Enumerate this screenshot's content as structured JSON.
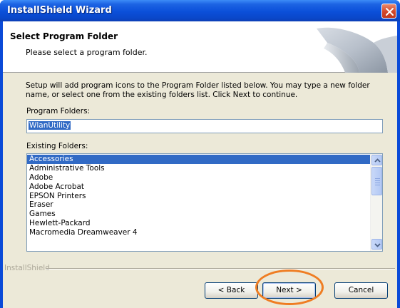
{
  "window": {
    "title": "InstallShield Wizard"
  },
  "header": {
    "title": "Select Program Folder",
    "subtitle": "Please select a program folder."
  },
  "body": {
    "description_line1": "Setup will add program icons to the Program Folder listed below.  You may type a new folder",
    "description_line2": "name, or select one from the existing folders list.  Click Next to continue.",
    "program_folders_label": "Program Folders:",
    "program_folder_value": "WlanUtility",
    "existing_folders_label": "Existing Folders:",
    "existing_folders": [
      "Accessories",
      "Administrative Tools",
      "Adobe",
      "Adobe Acrobat",
      "EPSON Printers",
      "Eraser",
      "Games",
      "Hewlett-Packard",
      "Macromedia Dreamweaver 4"
    ],
    "selected_folder_index": 0
  },
  "footer": {
    "brand": "InstallShield",
    "back_label": "< Back",
    "next_label": "Next >",
    "cancel_label": "Cancel"
  },
  "colors": {
    "titlebar": "#0a4ad8",
    "selection": "#316ac5",
    "highlight_ring": "#ef7d22"
  },
  "icons": {
    "close": "close-icon",
    "scroll_up": "arrow-up-icon",
    "scroll_down": "arrow-down-icon"
  }
}
